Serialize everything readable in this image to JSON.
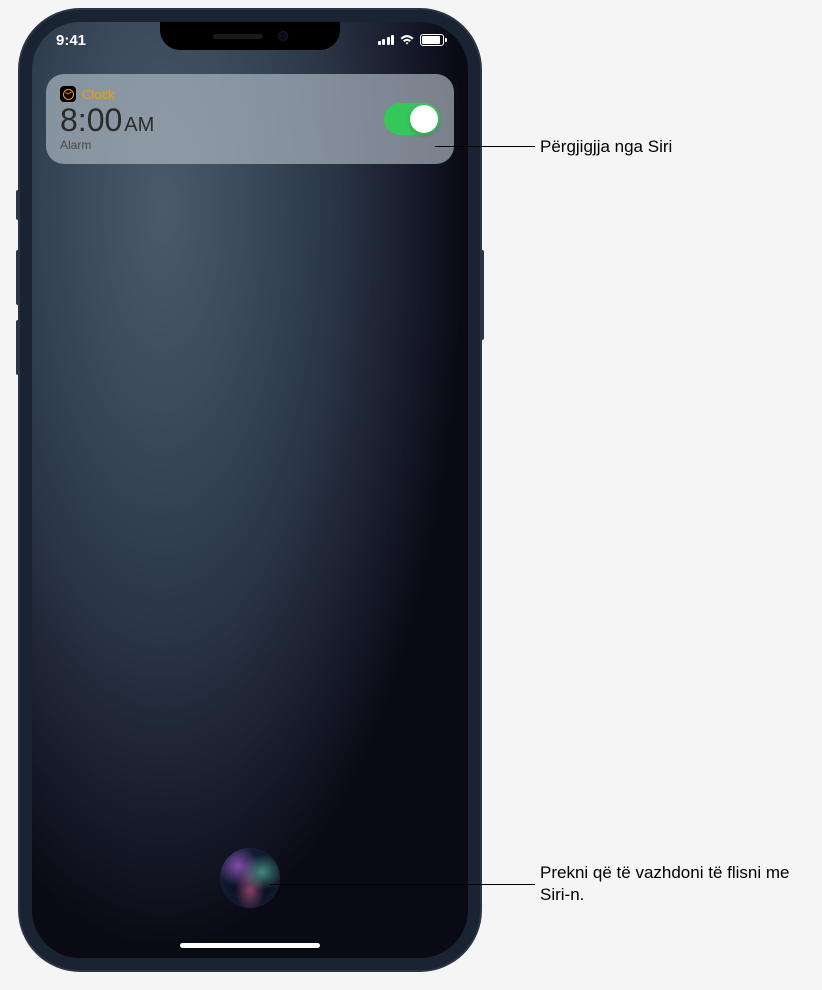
{
  "status": {
    "time": "9:41"
  },
  "notification": {
    "app_name": "Clock",
    "time_value": "8:00",
    "time_ampm": "AM",
    "subtitle": "Alarm",
    "toggle_on": true
  },
  "callouts": {
    "siri_response": "Përgjigjja nga Siri",
    "siri_continue": "Prekni që të vazhdoni të flisni me Siri-n."
  },
  "colors": {
    "toggle_on": "#34c759",
    "accent_orange": "#ff9500"
  }
}
